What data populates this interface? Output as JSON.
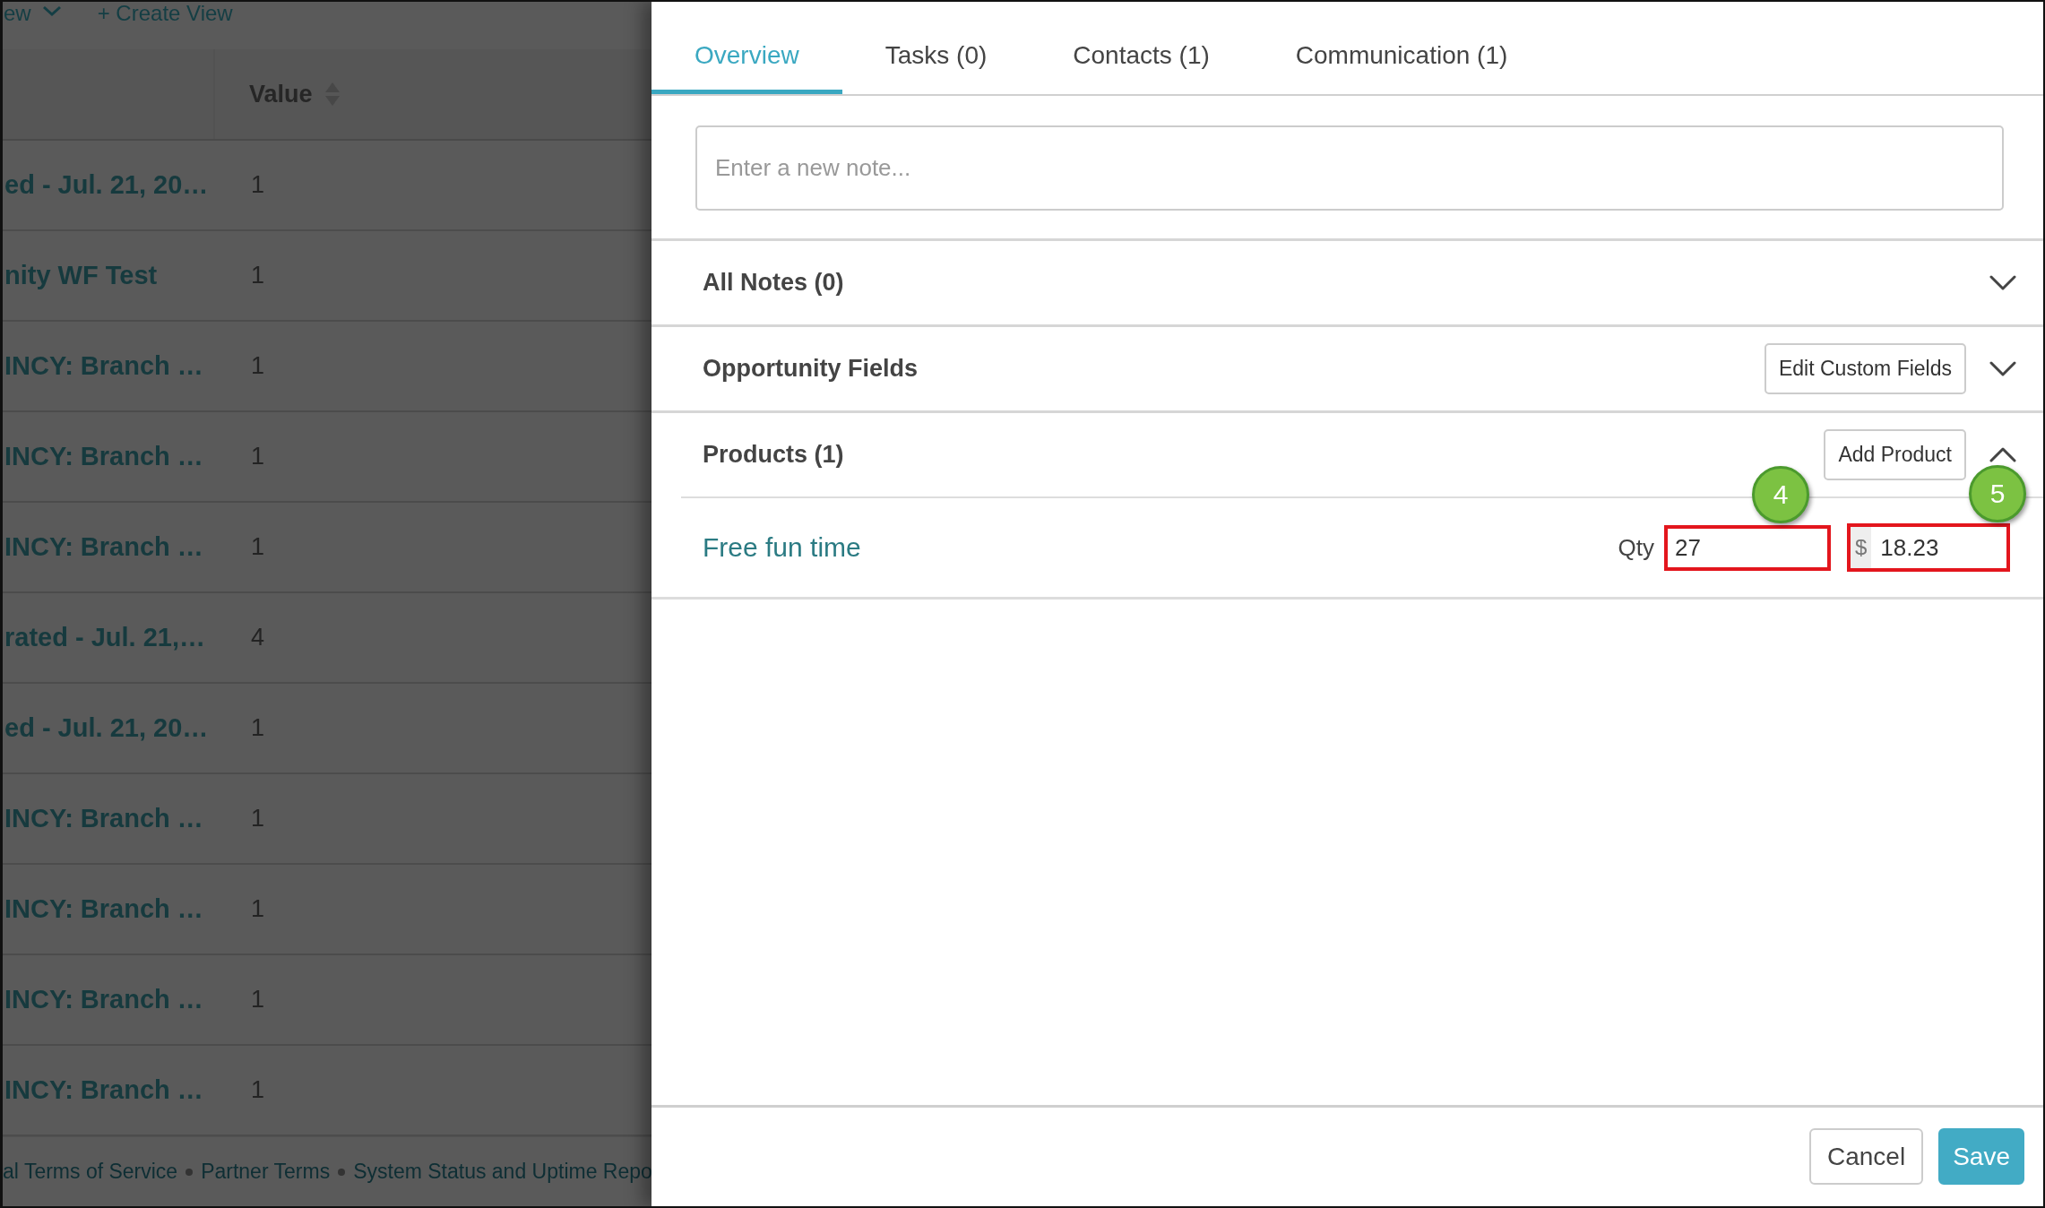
{
  "list_view": {
    "toolbar": {
      "view_dropdown": "ew",
      "create_view": "+ Create View"
    },
    "table": {
      "value_header": "Value",
      "rows": [
        {
          "column_1": "ed - Jul. 21, 20…",
          "value": "1"
        },
        {
          "column_1": "nity WF Test",
          "value": "1"
        },
        {
          "column_1": "INCY: Branch …",
          "value": "1"
        },
        {
          "column_1": "INCY: Branch …",
          "value": "1"
        },
        {
          "column_1": "INCY: Branch …",
          "value": "1"
        },
        {
          "column_1": "rated - Jul. 21,…",
          "value": "4"
        },
        {
          "column_1": "ed - Jul. 21, 20…",
          "value": "1"
        },
        {
          "column_1": "INCY: Branch …",
          "value": "1"
        },
        {
          "column_1": "INCY: Branch …",
          "value": "1"
        },
        {
          "column_1": "INCY: Branch …",
          "value": "1"
        },
        {
          "column_1": "INCY: Branch …",
          "value": "1"
        }
      ]
    },
    "footer_links": [
      "al Terms of Service",
      "Partner Terms",
      "System Status and Uptime Repo"
    ]
  },
  "panel": {
    "tabs": [
      {
        "label": "Overview",
        "selected": true
      },
      {
        "label": "Tasks (0)",
        "selected": false
      },
      {
        "label": "Contacts (1)",
        "selected": false
      },
      {
        "label": "Communication (1)",
        "selected": false
      }
    ],
    "note": {
      "placeholder": "Enter a new note..."
    },
    "sections": [
      {
        "title": "All Notes (0)",
        "expanded": false
      },
      {
        "title": "Opportunity Fields",
        "button": "Edit Custom Fields",
        "expanded": false
      },
      {
        "title": "Products (1)",
        "button": "Add Product",
        "expanded": true,
        "products": [
          {
            "name": "Free fun time",
            "qty_label": "Qty",
            "qty": {
              "value": "27",
              "highlighted": true,
              "step": "4"
            },
            "currency": "$",
            "price": {
              "value": "18.23",
              "highlighted": true,
              "step": "5"
            }
          }
        ]
      }
    ],
    "buttons": [
      {
        "label": "Cancel",
        "kind": "secondary"
      },
      {
        "label": "Save",
        "kind": "primary"
      }
    ]
  }
}
